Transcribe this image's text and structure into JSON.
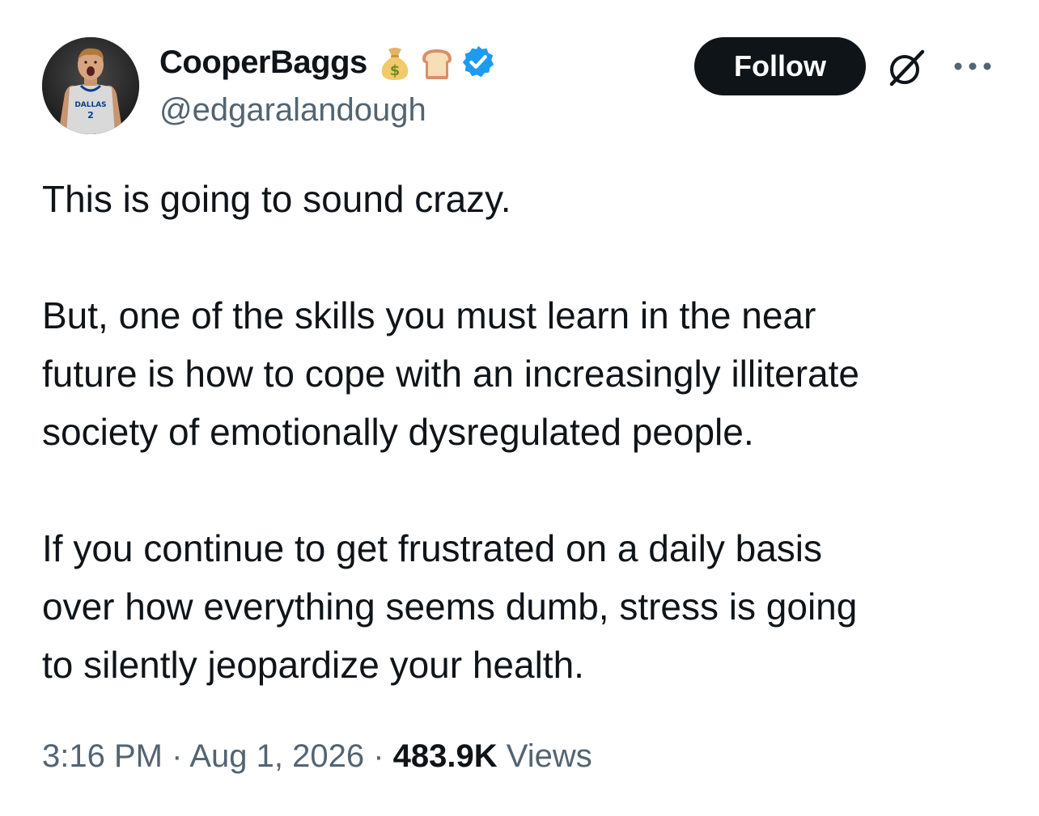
{
  "author": {
    "display_name": "CooperBaggs",
    "handle": "@edgaralandough",
    "badges": [
      "money-bag-emoji",
      "bread-emoji",
      "verified-badge-icon"
    ],
    "avatar_jersey_text": "DALLAS",
    "avatar_jersey_number": "2"
  },
  "header": {
    "follow_label": "Follow",
    "grok_icon": "grok-icon",
    "more_icon": "more-icon"
  },
  "tweet": {
    "paragraphs": [
      "This is going to sound crazy.",
      "But, one of the skills you must learn in the near\nfuture is how to cope with an increasingly illiterate\nsociety of emotionally dysregulated people.",
      "If you continue to get frustrated on a daily basis\nover how everything seems dumb, stress is going\nto silently jeopardize your health."
    ]
  },
  "meta": {
    "time": "3:16 PM",
    "separator": "·",
    "date": "Aug 1, 2026",
    "views_count": "483.9K",
    "views_label": "Views"
  },
  "colors": {
    "text_primary": "#0f1419",
    "text_secondary": "#536471",
    "verified_blue": "#1d9bf0",
    "button_bg": "#0f1419"
  }
}
